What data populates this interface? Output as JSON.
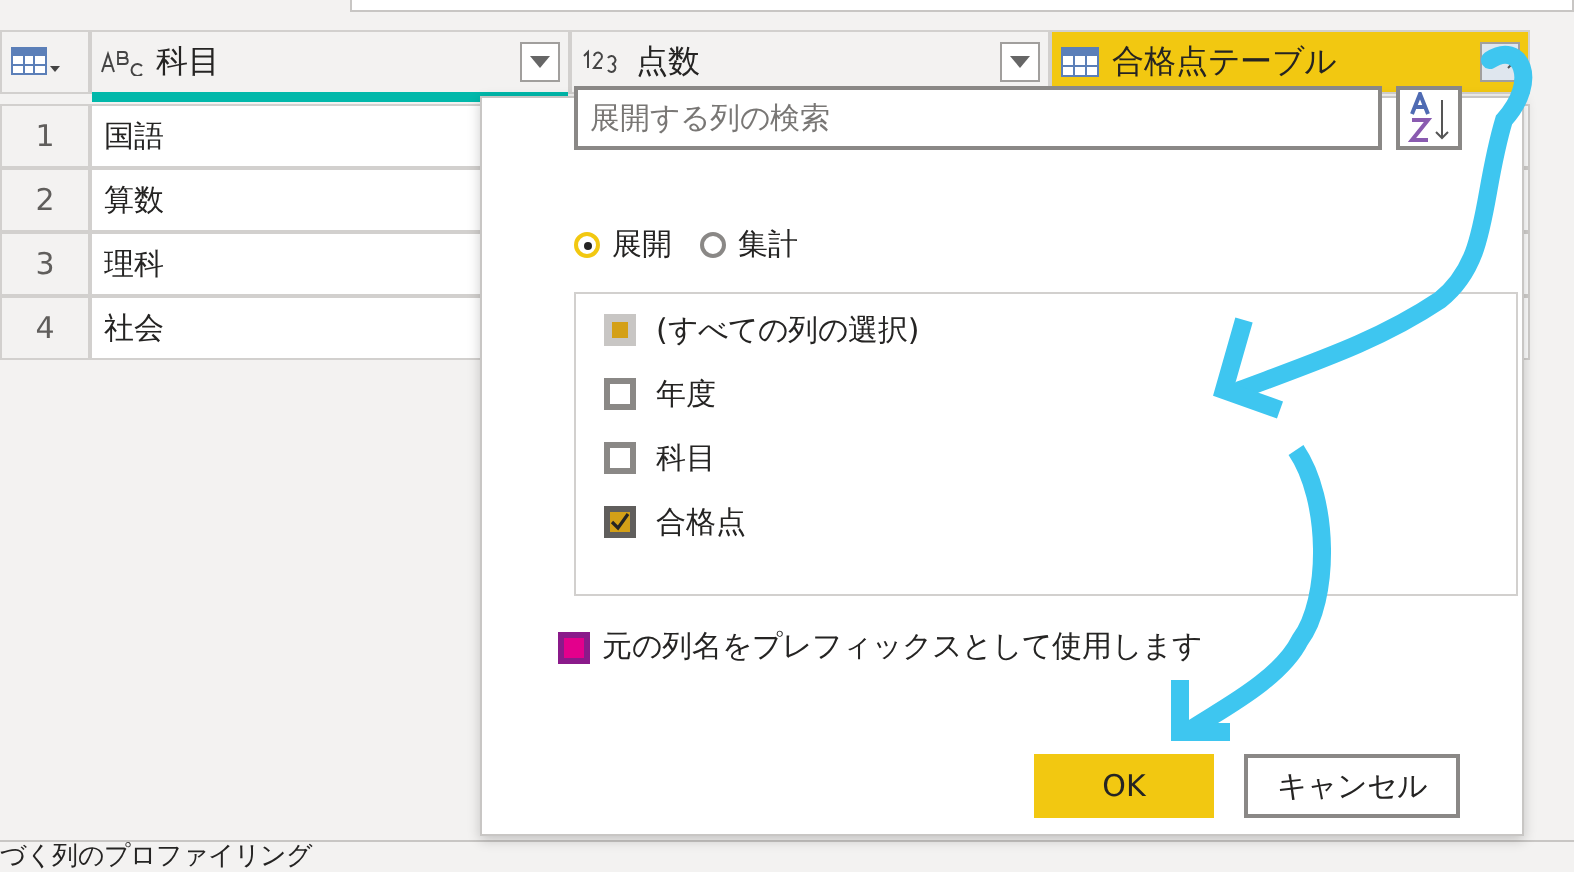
{
  "table": {
    "columns": [
      {
        "label": "科目",
        "kind": "text"
      },
      {
        "label": "点数",
        "kind": "number"
      },
      {
        "label": "合格点テーブル",
        "kind": "table",
        "selected": true
      }
    ],
    "rows": [
      {
        "number": "1",
        "subject": "国語"
      },
      {
        "number": "2",
        "subject": "算数"
      },
      {
        "number": "3",
        "subject": "理科"
      },
      {
        "number": "4",
        "subject": "社会"
      }
    ]
  },
  "status_bar": "づく列のプロファイリング",
  "dialog": {
    "search": {
      "placeholder": "展開する列の検索"
    },
    "modes": [
      {
        "label": "展開",
        "selected": true
      },
      {
        "label": "集計",
        "selected": false
      }
    ],
    "columns": [
      {
        "label": "(すべての列の選択)",
        "kind": "partial",
        "checked": false
      },
      {
        "label": "年度",
        "kind": "normal",
        "checked": false
      },
      {
        "label": "科目",
        "kind": "normal",
        "checked": false
      },
      {
        "label": "合格点",
        "kind": "normal",
        "checked": true
      }
    ],
    "prefix": {
      "label": "元の列名をプレフィックスとして使用します",
      "checked": false
    },
    "buttons": [
      {
        "label": "OK",
        "kind": "primary"
      },
      {
        "label": "キャンセル",
        "kind": "secondary"
      }
    ]
  }
}
